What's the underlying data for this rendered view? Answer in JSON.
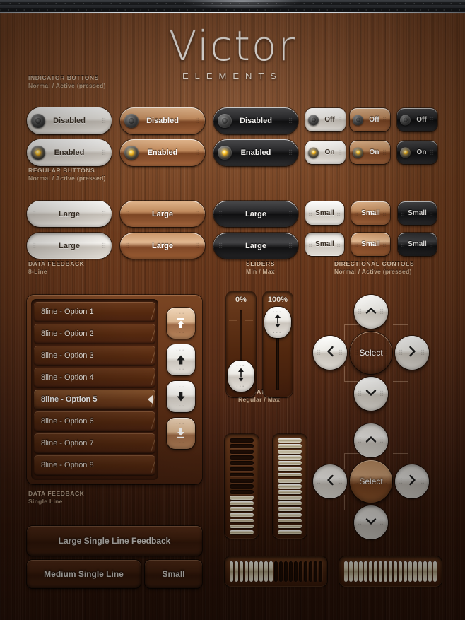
{
  "header": {
    "title": "Victor",
    "subtitle": "ELEMENTS"
  },
  "sections": {
    "indicator_buttons": {
      "title": "INDICATOR BUTTONS",
      "subtitle": "Normal / Active (pressed)"
    },
    "regular_buttons": {
      "title": "REGULAR BUTTONS",
      "subtitle": "Normal / Active (pressed)"
    },
    "data_feedback_8": {
      "title": "DATA FEEDBACK",
      "subtitle": "8-Line"
    },
    "data_feedback_1": {
      "title": "DATA FEEDBACK",
      "subtitle": "Single Line"
    },
    "sliders": {
      "title": "SLIDERS",
      "subtitle": "Min / Max"
    },
    "indicators": {
      "title": "INDICATORS",
      "subtitle": "Regular / Max"
    },
    "directional": {
      "title": "DIRECTIONAL CONTOLS",
      "subtitle": "Normal / Active (pressed)"
    }
  },
  "indicator_buttons": {
    "large": [
      {
        "label": "Disabled",
        "style": "silver",
        "state": "off"
      },
      {
        "label": "Disabled",
        "style": "wood",
        "state": "off"
      },
      {
        "label": "Disabled",
        "style": "dark",
        "state": "off"
      },
      {
        "label": "Enabled",
        "style": "silver",
        "state": "on"
      },
      {
        "label": "Enabled",
        "style": "wood",
        "state": "on"
      },
      {
        "label": "Enabled",
        "style": "dark",
        "state": "on"
      }
    ],
    "small": [
      {
        "label": "Off",
        "style": "silver",
        "state": "off"
      },
      {
        "label": "Off",
        "style": "wood",
        "state": "off"
      },
      {
        "label": "Off",
        "style": "dark",
        "state": "off"
      },
      {
        "label": "On",
        "style": "silver",
        "state": "on"
      },
      {
        "label": "On",
        "style": "wood",
        "state": "on"
      },
      {
        "label": "On",
        "style": "dark",
        "state": "on"
      }
    ]
  },
  "regular_buttons": {
    "large": [
      {
        "label": "Large",
        "style": "silver",
        "pressed": false
      },
      {
        "label": "Large",
        "style": "wood",
        "pressed": false
      },
      {
        "label": "Large",
        "style": "dark",
        "pressed": false
      },
      {
        "label": "Large",
        "style": "silver",
        "pressed": true
      },
      {
        "label": "Large",
        "style": "wood",
        "pressed": true
      },
      {
        "label": "Large",
        "style": "dark",
        "pressed": true
      }
    ],
    "small": [
      {
        "label": "Small",
        "style": "silver",
        "pressed": false
      },
      {
        "label": "Small",
        "style": "wood",
        "pressed": false
      },
      {
        "label": "Small",
        "style": "dark",
        "pressed": false
      },
      {
        "label": "Small",
        "style": "silver",
        "pressed": true
      },
      {
        "label": "Small",
        "style": "wood",
        "pressed": true
      },
      {
        "label": "Small",
        "style": "dark",
        "pressed": true
      }
    ]
  },
  "list": {
    "rows": [
      {
        "label": "8line - Option 1",
        "selected": false
      },
      {
        "label": "8line - Option 2",
        "selected": false
      },
      {
        "label": "8line - Option 3",
        "selected": false
      },
      {
        "label": "8line - Option 4",
        "selected": false
      },
      {
        "label": "8line - Option 5",
        "selected": true
      },
      {
        "label": "8line - Option 6",
        "selected": false
      },
      {
        "label": "8line - Option 7",
        "selected": false
      },
      {
        "label": "8line - Option 8",
        "selected": false
      }
    ],
    "scroll_buttons": [
      {
        "icon": "scroll-to-top-icon",
        "style": "tan"
      },
      {
        "icon": "scroll-up-icon",
        "style": "silver"
      },
      {
        "icon": "scroll-down-icon",
        "style": "silver"
      },
      {
        "icon": "scroll-to-bottom-icon",
        "style": "tan"
      }
    ]
  },
  "single_line": {
    "large": "Large Single Line Feedback",
    "medium": "Medium Single Line",
    "small": "Small"
  },
  "sliders": [
    {
      "value_label": "0%",
      "value": 0,
      "handle_position": "bottom"
    },
    {
      "value_label": "100%",
      "value": 100,
      "handle_position": "top"
    }
  ],
  "indicators": {
    "vertical": [
      {
        "name": "regular",
        "total": 17,
        "lit": 7
      },
      {
        "name": "max",
        "total": 17,
        "lit": 17
      }
    ],
    "horizontal": [
      {
        "name": "regular",
        "total": 19,
        "lit": 9
      },
      {
        "name": "max",
        "total": 19,
        "lit": 19
      }
    ]
  },
  "directional": {
    "select_label": "Select",
    "pads": [
      {
        "pressed": false,
        "up": "up-arrow-icon",
        "down": "down-arrow-icon",
        "left": "left-arrow-icon",
        "right": "right-arrow-icon"
      },
      {
        "pressed": true,
        "up": "up-arrow-icon",
        "down": "down-arrow-icon",
        "left": "left-arrow-icon",
        "right": "right-arrow-icon"
      }
    ]
  },
  "colors": {
    "wood_light": "#7b4524",
    "wood_dark": "#2a1208",
    "accent_led": "#ffd24a",
    "label_text": "#d7bfa6",
    "segment_lit": "#ece2c6"
  }
}
